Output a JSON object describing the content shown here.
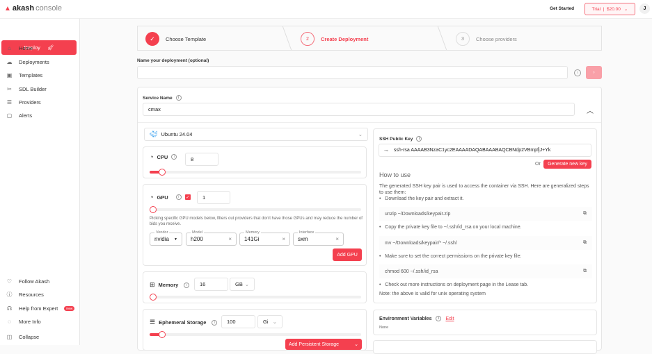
{
  "header": {
    "logo_bold": "akash",
    "logo_light": "console",
    "get_started": "Get Started",
    "trial": "Trial  |  $20.00",
    "avatar": "J"
  },
  "sidebar": {
    "deploy": "Deploy",
    "items": [
      {
        "label": "Home",
        "icon": "home-icon"
      },
      {
        "label": "Deployments",
        "icon": "cloud-icon"
      },
      {
        "label": "Templates",
        "icon": "template-icon"
      },
      {
        "label": "SDL Builder",
        "icon": "builder-icon"
      },
      {
        "label": "Providers",
        "icon": "server-icon"
      },
      {
        "label": "Alerts",
        "icon": "message-icon"
      }
    ],
    "bottom": [
      {
        "label": "Follow Akash",
        "icon": "heart-icon"
      },
      {
        "label": "Resources",
        "icon": "info-icon"
      },
      {
        "label": "Help from Expert",
        "icon": "headset-icon",
        "badge": "New"
      },
      {
        "label": "More Info",
        "icon": "more-icon"
      },
      {
        "label": "Collapse",
        "icon": "collapse-icon"
      }
    ]
  },
  "stepper": [
    {
      "num": "✓",
      "label": "Choose Template"
    },
    {
      "num": "2",
      "label": "Create Deployment"
    },
    {
      "num": "3",
      "label": "Choose providers"
    }
  ],
  "name": {
    "label": "Name your deployment (optional)",
    "value": ""
  },
  "service": {
    "label": "Service Name",
    "value": "cmax"
  },
  "image": {
    "value": "Ubuntu 24.04"
  },
  "cpu": {
    "label": "CPU",
    "value": "8",
    "fraction": 0.05
  },
  "gpu": {
    "label": "GPU",
    "value": "1",
    "checked": true,
    "fraction": 0,
    "note": "Picking specific GPU models below, filters out providers that don't have those GPUs and may reduce the number of bids you receive.",
    "vendor": {
      "legend": "Vendor",
      "value": "nvidia"
    },
    "model": {
      "legend": "Model",
      "value": "h200"
    },
    "memory": {
      "legend": "Memory",
      "value": "141Gi"
    },
    "interface": {
      "legend": "Interface",
      "value": "sxm"
    },
    "add": "Add GPU"
  },
  "memory": {
    "label": "Memory",
    "value": "16",
    "unit": "GB",
    "fraction": 0
  },
  "storage": {
    "label": "Ephemeral Storage",
    "value": "100",
    "unit": "Gi",
    "fraction": 0.05,
    "add": "Add Persistent Storage"
  },
  "ssh": {
    "label": "SSH Public Key",
    "value": "ssh-rsa AAAAB3NzaC1yc2EAAAADAQABAAABAQCBNdp2VBmpfjJ+Yk",
    "or": "Or",
    "generate": "Generate new key",
    "howto": "How to use",
    "intro": "The generated SSH key pair is used to access the container via SSH. Here are generalized steps to use them:",
    "steps": [
      {
        "text": "Download the key pair and extract it.",
        "code": "unzip ~/Downloads/keypair.zip"
      },
      {
        "text": "Copy the private key file to ~/.ssh/id_rsa on your local machine.",
        "code": "mv ~/Downloads/keypair/* ~/.ssh/"
      },
      {
        "text": "Make sure to set the correct permissions on the private key file:",
        "code": "chmod 600 ~/.ssh/id_rsa"
      },
      {
        "text": "Check out more instructions on deployment page in the Lease tab."
      }
    ],
    "note": "Note: the above is valid for unix operating system"
  },
  "env": {
    "label": "Environment Variables",
    "edit": "Edit",
    "value": "None"
  },
  "colors": {
    "accent": "#f4404f"
  }
}
